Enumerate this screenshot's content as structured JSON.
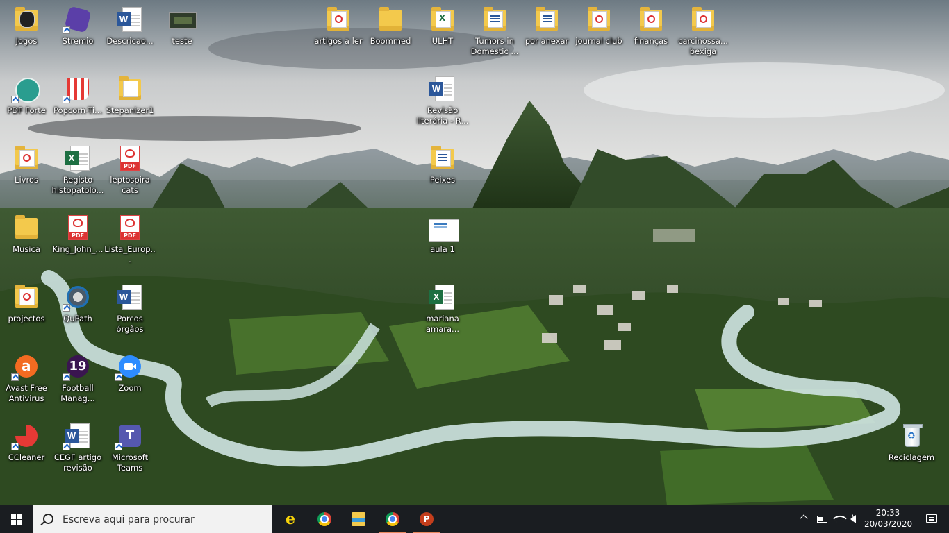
{
  "desktop": {
    "icons": [
      {
        "label": "Jogos",
        "icon": "folder-icon"
      },
      {
        "label": "Stremio",
        "icon": "stremio-icon"
      },
      {
        "label": "Descricao...",
        "icon": "word-document-icon"
      },
      {
        "label": "teste",
        "icon": "video-thumbnail-icon"
      },
      {
        "label": "artigos a ler",
        "icon": "folder-icon"
      },
      {
        "label": "Boommed",
        "icon": "folder-icon"
      },
      {
        "label": "ULHT",
        "icon": "folder-icon"
      },
      {
        "label": "Tumors in Domestic ...",
        "icon": "folder-icon"
      },
      {
        "label": "por anexar",
        "icon": "folder-icon"
      },
      {
        "label": "journal club",
        "icon": "folder-icon"
      },
      {
        "label": "finanças",
        "icon": "folder-icon"
      },
      {
        "label": "carcinossa... bexiga",
        "icon": "folder-icon"
      },
      {
        "label": "PDF Forte",
        "icon": "pdf-forte-icon"
      },
      {
        "label": "Popcorn-Ti...",
        "icon": "popcorn-time-icon"
      },
      {
        "label": "Stepanizer1",
        "icon": "folder-icon"
      },
      {
        "label": "Revisão literária - R...",
        "icon": "word-document-icon"
      },
      {
        "label": "Livros",
        "icon": "folder-icon"
      },
      {
        "label": "Registo histopatolo...",
        "icon": "excel-document-icon"
      },
      {
        "label": "leptospira cats",
        "icon": "pdf-document-icon"
      },
      {
        "label": "Peixes",
        "icon": "folder-icon"
      },
      {
        "label": "Musica",
        "icon": "folder-icon"
      },
      {
        "label": "King_John_...",
        "icon": "pdf-document-icon"
      },
      {
        "label": "Lista_Europ...",
        "icon": "pdf-document-icon"
      },
      {
        "label": "aula 1",
        "icon": "image-thumbnail-icon"
      },
      {
        "label": "projectos",
        "icon": "folder-icon"
      },
      {
        "label": "QuPath",
        "icon": "qupath-icon"
      },
      {
        "label": "Porcos órgãos",
        "icon": "word-document-icon"
      },
      {
        "label": "mariana amara...",
        "icon": "excel-document-icon"
      },
      {
        "label": "Avast Free Antivirus",
        "icon": "avast-icon"
      },
      {
        "label": "Football Manag...",
        "icon": "football-manager-icon"
      },
      {
        "label": "Zoom",
        "icon": "zoom-icon"
      },
      {
        "label": "CCleaner",
        "icon": "ccleaner-icon"
      },
      {
        "label": "CEGF artigo revisão",
        "icon": "word-document-icon"
      },
      {
        "label": "Microsoft Teams",
        "icon": "teams-icon"
      },
      {
        "label": "Reciclagem",
        "icon": "recycle-bin-icon"
      }
    ]
  },
  "taskbar": {
    "search_placeholder": "Escreva aqui para procurar",
    "pinned": [
      {
        "name": "Internet Explorer",
        "icon": "internet-explorer-icon"
      },
      {
        "name": "Google Chrome",
        "icon": "chrome-icon"
      },
      {
        "name": "File Explorer",
        "icon": "file-explorer-icon"
      },
      {
        "name": "Google Chrome",
        "icon": "chrome-icon"
      },
      {
        "name": "PowerPoint",
        "icon": "powerpoint-icon"
      }
    ],
    "clock": {
      "time": "20:33",
      "date": "20/03/2020"
    }
  }
}
